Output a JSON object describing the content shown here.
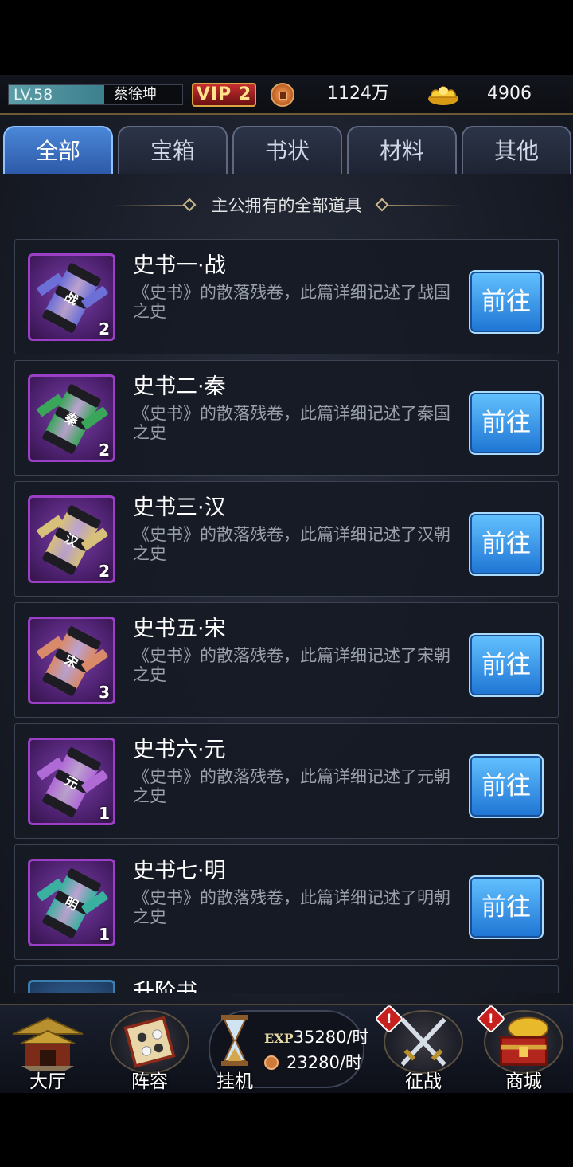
{
  "player": {
    "level": "LV.58",
    "name": "蔡徐坤",
    "vip": "VIP 2",
    "coins": "1124万",
    "gold": "4906"
  },
  "tabs": [
    {
      "label": "全部",
      "active": true
    },
    {
      "label": "宝箱",
      "active": false
    },
    {
      "label": "书状",
      "active": false
    },
    {
      "label": "材料",
      "active": false
    },
    {
      "label": "其他",
      "active": false
    }
  ],
  "section_title": "主公拥有的全部道具",
  "items": [
    {
      "name": "史书一·战",
      "desc": "《史书》的散落残卷，此篇详细记述了战国之史",
      "qty": "2",
      "glyph": "战",
      "color": "#6b6fd6",
      "button": "前往"
    },
    {
      "name": "史书二·秦",
      "desc": "《史书》的散落残卷，此篇详细记述了秦国之史",
      "qty": "2",
      "glyph": "秦",
      "color": "#3aa65a",
      "button": "前往"
    },
    {
      "name": "史书三·汉",
      "desc": "《史书》的散落残卷，此篇详细记述了汉朝之史",
      "qty": "2",
      "glyph": "汉",
      "color": "#d6c07a",
      "button": "前往"
    },
    {
      "name": "史书五·宋",
      "desc": "《史书》的散落残卷，此篇详细记述了宋朝之史",
      "qty": "3",
      "glyph": "宋",
      "color": "#d98a6a",
      "button": "前往"
    },
    {
      "name": "史书六·元",
      "desc": "《史书》的散落残卷，此篇详细记述了元朝之史",
      "qty": "1",
      "glyph": "元",
      "color": "#b06ad6",
      "button": "前往"
    },
    {
      "name": "史书七·明",
      "desc": "《史书》的散落残卷，此篇详细记述了明朝之史",
      "qty": "1",
      "glyph": "明",
      "color": "#3ab0a0",
      "button": "前往"
    },
    {
      "name": "升阶书",
      "desc": "",
      "qty": "",
      "glyph": "",
      "color": "#3a7fb0",
      "button": ""
    }
  ],
  "nav": {
    "hall": "大厅",
    "lineup": "阵容",
    "idle": "挂机",
    "exp_label": "EXP",
    "exp_rate": "35280/时",
    "coin_rate": "23280/时",
    "campaign": "征战",
    "shop": "商城",
    "badge": "!"
  }
}
